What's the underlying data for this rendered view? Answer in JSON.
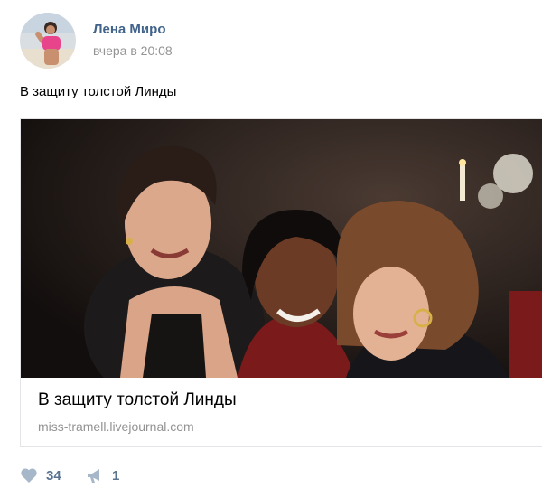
{
  "post": {
    "author": "Лена Миро",
    "time": "вчера в 20:08",
    "text": "В защиту толстой Линды"
  },
  "link": {
    "title": "В защиту толстой Линды",
    "domain": "miss-tramell.livejournal.com"
  },
  "actions": {
    "likes": "34",
    "shares": "1"
  },
  "icons": {
    "like": "heart-icon",
    "share": "megaphone-icon"
  },
  "colors": {
    "author_link": "#42648b",
    "muted_text": "#939393",
    "action_icon": "#a6b7ca",
    "action_count": "#5a7391"
  }
}
